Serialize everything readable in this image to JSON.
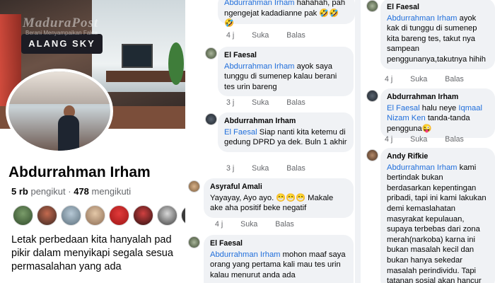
{
  "watermark": {
    "title": "MaduraPost",
    "subtitle": "Berani Menyampaikan Fakta"
  },
  "cover": {
    "sign_text": "ALANG SKY"
  },
  "profile": {
    "name": "Abdurrahman Irham",
    "followers_count": "5 rb",
    "followers_label": "pengikut",
    "separator": "·",
    "following_count": "478",
    "following_label": "mengikuti",
    "bio_lines": [
      "Letak perbedaan kita hanyalah pad",
      "pikir dalam menyikapi segala sesua",
      "permasalahan yang ada"
    ]
  },
  "colors": {
    "link": "#216fdb",
    "bubble": "#f0f2f5",
    "meta": "#65676b"
  },
  "comments_left": [
    {
      "author": "",
      "tag": "Abdurrahman Irham",
      "text_before": "",
      "text": " hahahah, pah ngengejat kadadianne pak 🤣🤣🤣",
      "time": "4 j",
      "like": "Suka",
      "reply": "Balas"
    },
    {
      "author": "El Faesal",
      "tag": "Abdurrahman Irham",
      "text": " ayok saya tunggu di sumenep kalau berani tes urin bareng",
      "time": "3 j",
      "like": "Suka",
      "reply": "Balas"
    },
    {
      "author": "Abdurrahman Irham",
      "tag": "El Faesal",
      "text": " Siap nanti kita ketemu di gedung DPRD ya dek. Buln 1 akhir",
      "time": "3 j",
      "like": "Suka",
      "reply": "Balas"
    },
    {
      "author": "Asyraful Amali",
      "tag": "",
      "text": "Yayayay, Ayo ayo. 😁😁😁 Makale ake aha positif beke negatif",
      "time": "4 j",
      "like": "Suka",
      "reply": "Balas"
    },
    {
      "author": "El Faesal",
      "tag": "Abdurrahman Irham",
      "text": " mohon maaf saya orang yang pertama kali mau tes urin kalau menurut anda ada",
      "time": "",
      "like": "",
      "reply": ""
    }
  ],
  "comments_right": [
    {
      "author": "El Faesal",
      "tag": "Abdurrahman Irham",
      "text": " ayok kak di tunggu di sumenep kita bareng tes, takut nya sampean penggunanya,takutnya hihih",
      "time": "4 j",
      "like": "Suka",
      "reply": "Balas"
    },
    {
      "author": "Abdurrahman Irham",
      "tag": "El Faesal",
      "text_mid": " halu neye ",
      "tag2": "Iqmaal Nizam Ken",
      "text": " tanda-tanda pengguna😜",
      "time": "4 j",
      "like": "Suka",
      "reply": "Balas"
    },
    {
      "author": "Andy Rifkie",
      "tag": "Abdurrahman Irham",
      "text": " kami bertindak bukan berdasarkan kepentingan pribadi, tapi ini kami lakukan demi kemaslahatan masyrakat kepulauan, supaya terbebas dari zona merah(narkoba) karna ini bukan masalah kecil dan bukan hanya sekedar masalah perindividu. Tapi tatanan sosial akan hancur",
      "time": "",
      "like": "",
      "reply": ""
    }
  ]
}
